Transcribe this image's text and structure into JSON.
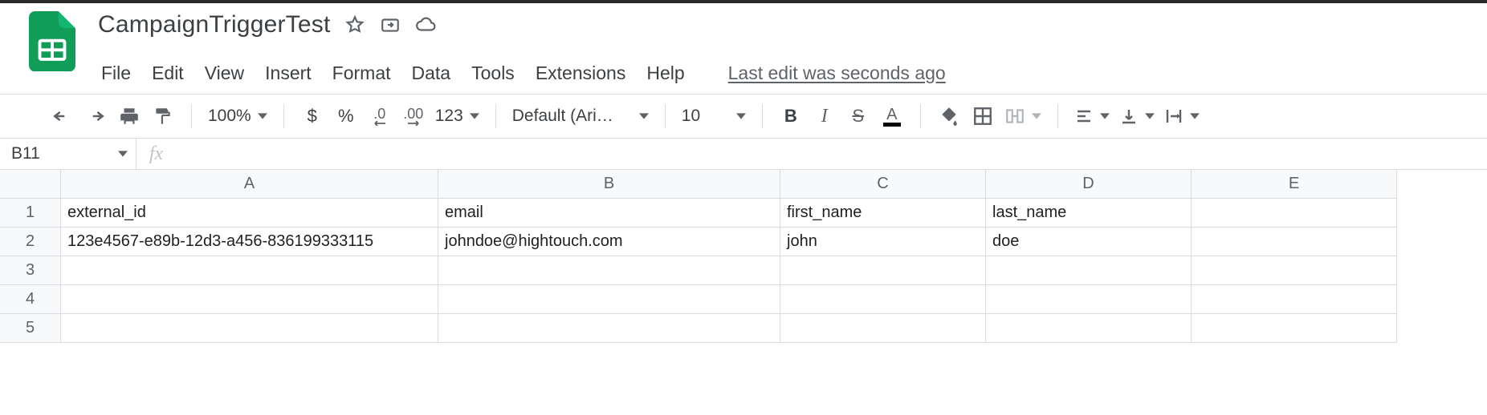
{
  "doc": {
    "title": "CampaignTriggerTest"
  },
  "menu": {
    "file": "File",
    "edit": "Edit",
    "view": "View",
    "insert": "Insert",
    "format": "Format",
    "data": "Data",
    "tools": "Tools",
    "extensions": "Extensions",
    "help": "Help",
    "last_edit": "Last edit was seconds ago"
  },
  "toolbar": {
    "zoom": "100%",
    "currency": "$",
    "percent": "%",
    "dec_dec": ".0",
    "dec_inc": ".00",
    "numfmt": "123",
    "font": "Default (Ari…",
    "size": "10",
    "bold": "B",
    "italic": "I",
    "strike": "S",
    "textcolor": "A"
  },
  "fx": {
    "cell": "B11",
    "formula": ""
  },
  "grid": {
    "columns": [
      "A",
      "B",
      "C",
      "D",
      "E"
    ],
    "rowNumbers": [
      "1",
      "2",
      "3",
      "4",
      "5"
    ],
    "rows": [
      [
        "external_id",
        "email",
        "first_name",
        "last_name",
        ""
      ],
      [
        "123e4567-e89b-12d3-a456-836199333115",
        "johndoe@hightouch.com",
        "john",
        "doe",
        ""
      ],
      [
        "",
        "",
        "",
        "",
        ""
      ],
      [
        "",
        "",
        "",
        "",
        ""
      ],
      [
        "",
        "",
        "",
        "",
        ""
      ]
    ]
  }
}
